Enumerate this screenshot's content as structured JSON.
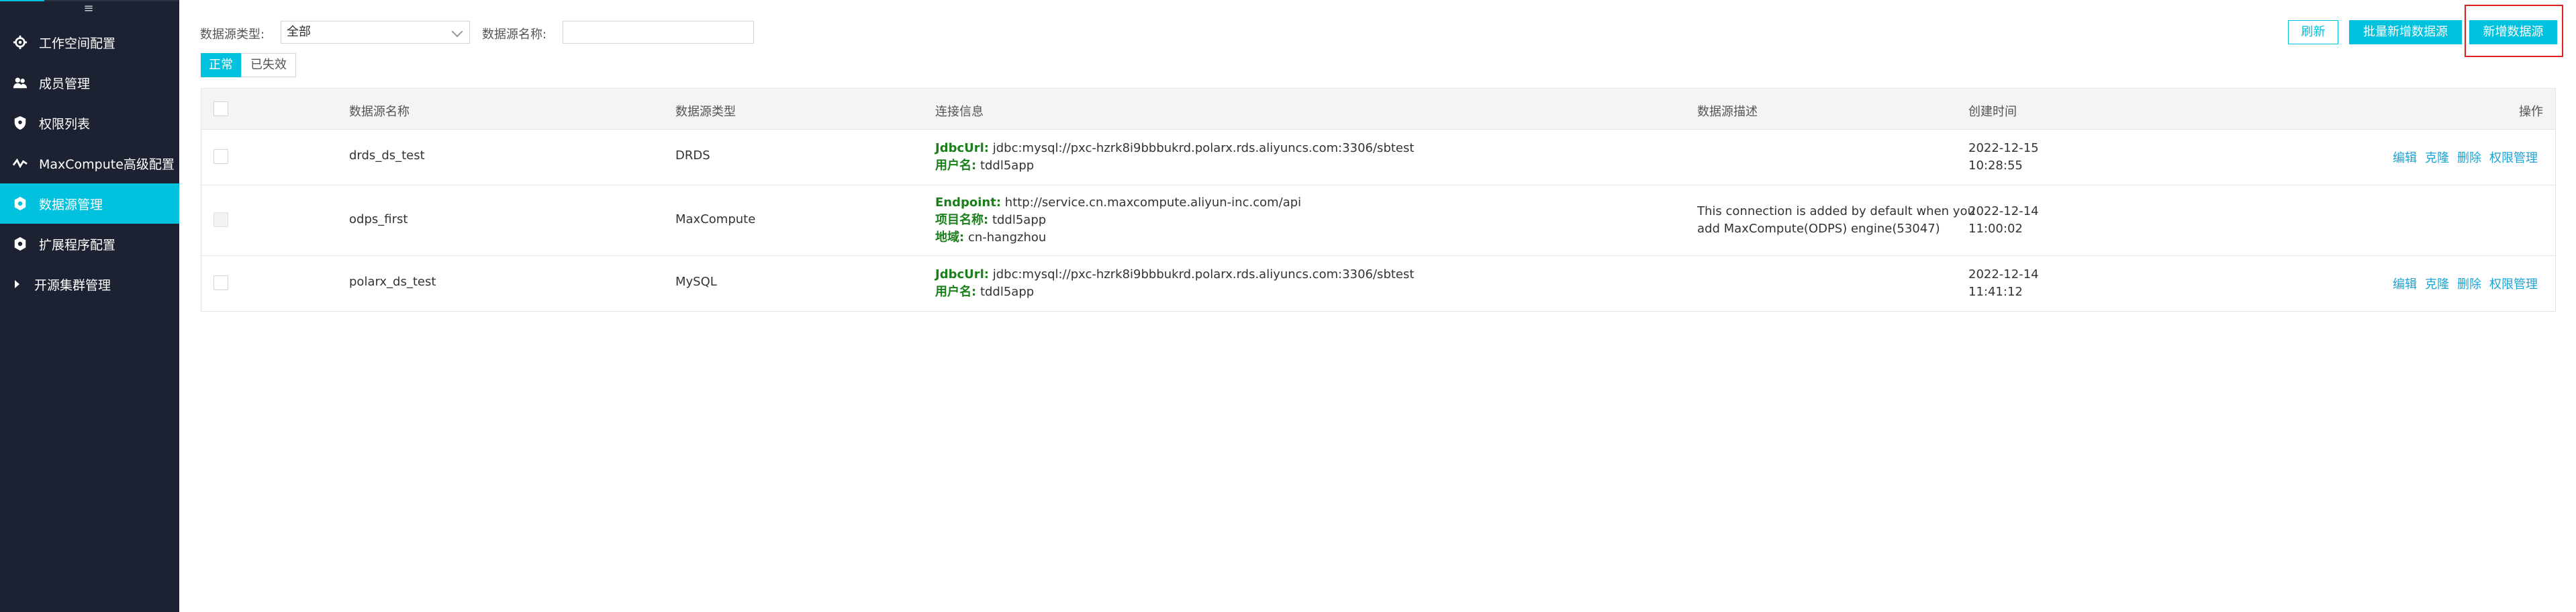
{
  "sidebar": {
    "items": [
      {
        "label": "工作空间配置",
        "icon": "gear-icon"
      },
      {
        "label": "成员管理",
        "icon": "users-icon"
      },
      {
        "label": "权限列表",
        "icon": "shield-icon"
      },
      {
        "label": "MaxCompute高级配置",
        "icon": "chart-line-icon"
      },
      {
        "label": "数据源管理",
        "icon": "gear-icon"
      },
      {
        "label": "扩展程序配置",
        "icon": "gear-icon"
      },
      {
        "label": "开源集群管理",
        "icon": "caret-right-icon"
      }
    ],
    "active_index": 4
  },
  "filters": {
    "type_label": "数据源类型:",
    "type_value": "全部",
    "name_label": "数据源名称:",
    "name_value": ""
  },
  "tabs": [
    {
      "label": "正常",
      "active": true
    },
    {
      "label": "已失效",
      "active": false
    }
  ],
  "toolbar": {
    "refresh": "刷新",
    "batch_add": "批量新增数据源",
    "add": "新增数据源"
  },
  "table": {
    "headers": {
      "name": "数据源名称",
      "type": "数据源类型",
      "conn": "连接信息",
      "desc": "数据源描述",
      "created": "创建时间",
      "ops": "操作"
    },
    "rows": [
      {
        "name": "drds_ds_test",
        "type": "DRDS",
        "conn": [
          {
            "key": "JdbcUrl:",
            "value": "jdbc:mysql://pxc-hzrk8i9bbbukrd.polarx.rds.aliyuncs.com:3306/sbtest"
          },
          {
            "key": "用户名:",
            "value": "tddl5app"
          }
        ],
        "desc": [
          "",
          ""
        ],
        "created_date": "2022-12-15",
        "created_time": "10:28:55",
        "actions": [
          "编辑",
          "克隆",
          "删除",
          "权限管理"
        ]
      },
      {
        "name": "odps_first",
        "type": "MaxCompute",
        "conn": [
          {
            "key": "Endpoint:",
            "value": "http://service.cn.maxcompute.aliyun-inc.com/api"
          },
          {
            "key": "项目名称:",
            "value": "tddl5app"
          },
          {
            "key": "地域:",
            "value": "cn-hangzhou"
          }
        ],
        "desc": [
          "This connection is added by default when you",
          "add MaxCompute(ODPS) engine(53047)"
        ],
        "created_date": "2022-12-14",
        "created_time": "11:00:02",
        "actions": []
      },
      {
        "name": "polarx_ds_test",
        "type": "MySQL",
        "conn": [
          {
            "key": "JdbcUrl:",
            "value": "jdbc:mysql://pxc-hzrk8i9bbbukrd.polarx.rds.aliyuncs.com:3306/sbtest"
          },
          {
            "key": "用户名:",
            "value": "tddl5app"
          }
        ],
        "desc": [
          "",
          ""
        ],
        "created_date": "2022-12-14",
        "created_time": "11:41:12",
        "actions": [
          "编辑",
          "克隆",
          "删除",
          "权限管理"
        ]
      }
    ]
  },
  "colors": {
    "sidebar_bg": "#1c2231",
    "accent": "#00c1de",
    "key_green": "#1a7f1a",
    "link": "#1aa3d6",
    "highlight": "#e02020"
  }
}
